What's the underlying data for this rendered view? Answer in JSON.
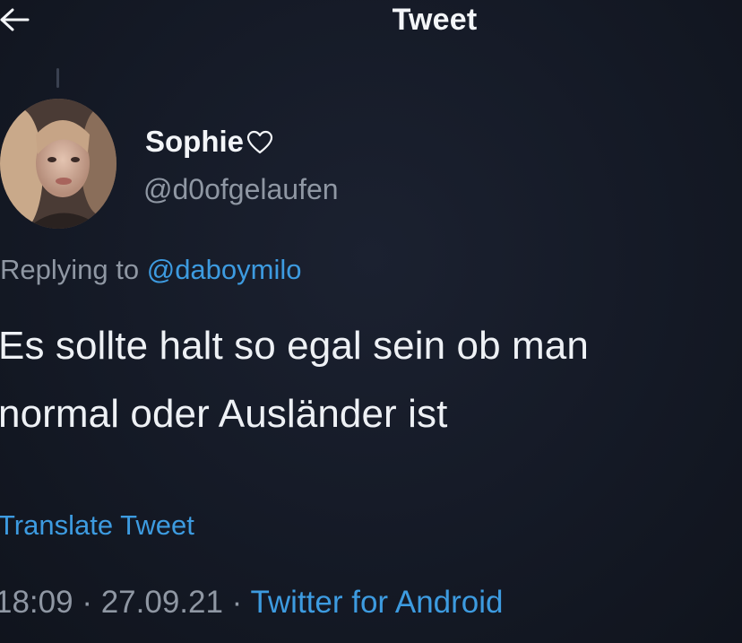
{
  "header": {
    "title": "Tweet",
    "back_icon": "arrow-left-icon"
  },
  "author": {
    "name": "Sophie",
    "heart_icon": "heart-outline-icon",
    "handle": "@d0ofgelaufen"
  },
  "reply": {
    "prefix": "Replying to",
    "mention": "@daboymilo"
  },
  "tweet": {
    "line1": "Es sollte halt so egal sein ob man",
    "line2": "normal oder Ausländer ist"
  },
  "translate_label": "Translate Tweet",
  "meta": {
    "time": "18:09",
    "sep1": " · ",
    "date": "27.09.21",
    "sep2": " · ",
    "source": "Twitter for Android"
  },
  "colors": {
    "background": "#151a26",
    "link": "#3d9be0",
    "secondary_text": "#8f97a3",
    "primary_text": "#eef1f5"
  }
}
